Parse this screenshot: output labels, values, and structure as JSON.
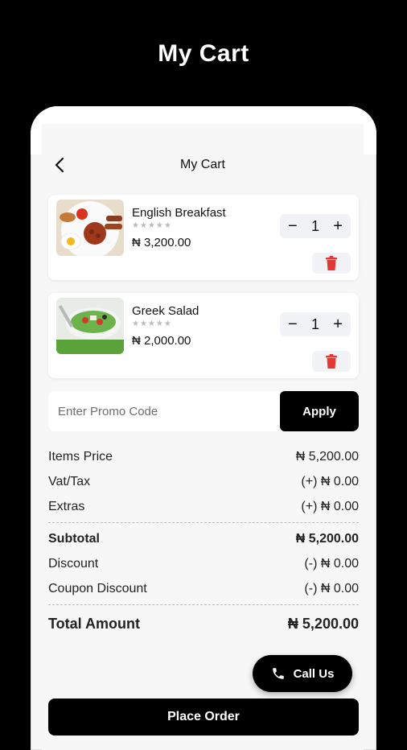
{
  "hero_title": "My Cart",
  "appbar": {
    "title": "My Cart",
    "back_icon": "chevron-left-icon"
  },
  "items": [
    {
      "name": "English Breakfast",
      "stars": "★★★★★",
      "price": "₦ 3,200.00",
      "qty": "1",
      "image": "breakfast-plate"
    },
    {
      "name": "Greek Salad",
      "stars": "★★★★★",
      "price": "₦ 2,000.00",
      "qty": "1",
      "image": "salad-bowl"
    }
  ],
  "promo": {
    "placeholder": "Enter Promo Code",
    "apply_label": "Apply"
  },
  "summary": {
    "items_price_label": "Items Price",
    "items_price_value": "₦ 5,200.00",
    "vat_label": "Vat/Tax",
    "vat_value": "(+) ₦ 0.00",
    "extras_label": "Extras",
    "extras_value": "(+) ₦ 0.00",
    "subtotal_label": "Subtotal",
    "subtotal_value": "₦ 5,200.00",
    "discount_label": "Discount",
    "discount_value": "(-) ₦ 0.00",
    "coupon_label": "Coupon Discount",
    "coupon_value": "(-) ₦ 0.00",
    "total_label": "Total Amount",
    "total_value": "₦ 5,200.00"
  },
  "call_us_label": "Call Us",
  "place_order_label": "Place Order",
  "colors": {
    "accent": "#000000",
    "delete": "#e53935",
    "background": "#f7f7f7"
  }
}
